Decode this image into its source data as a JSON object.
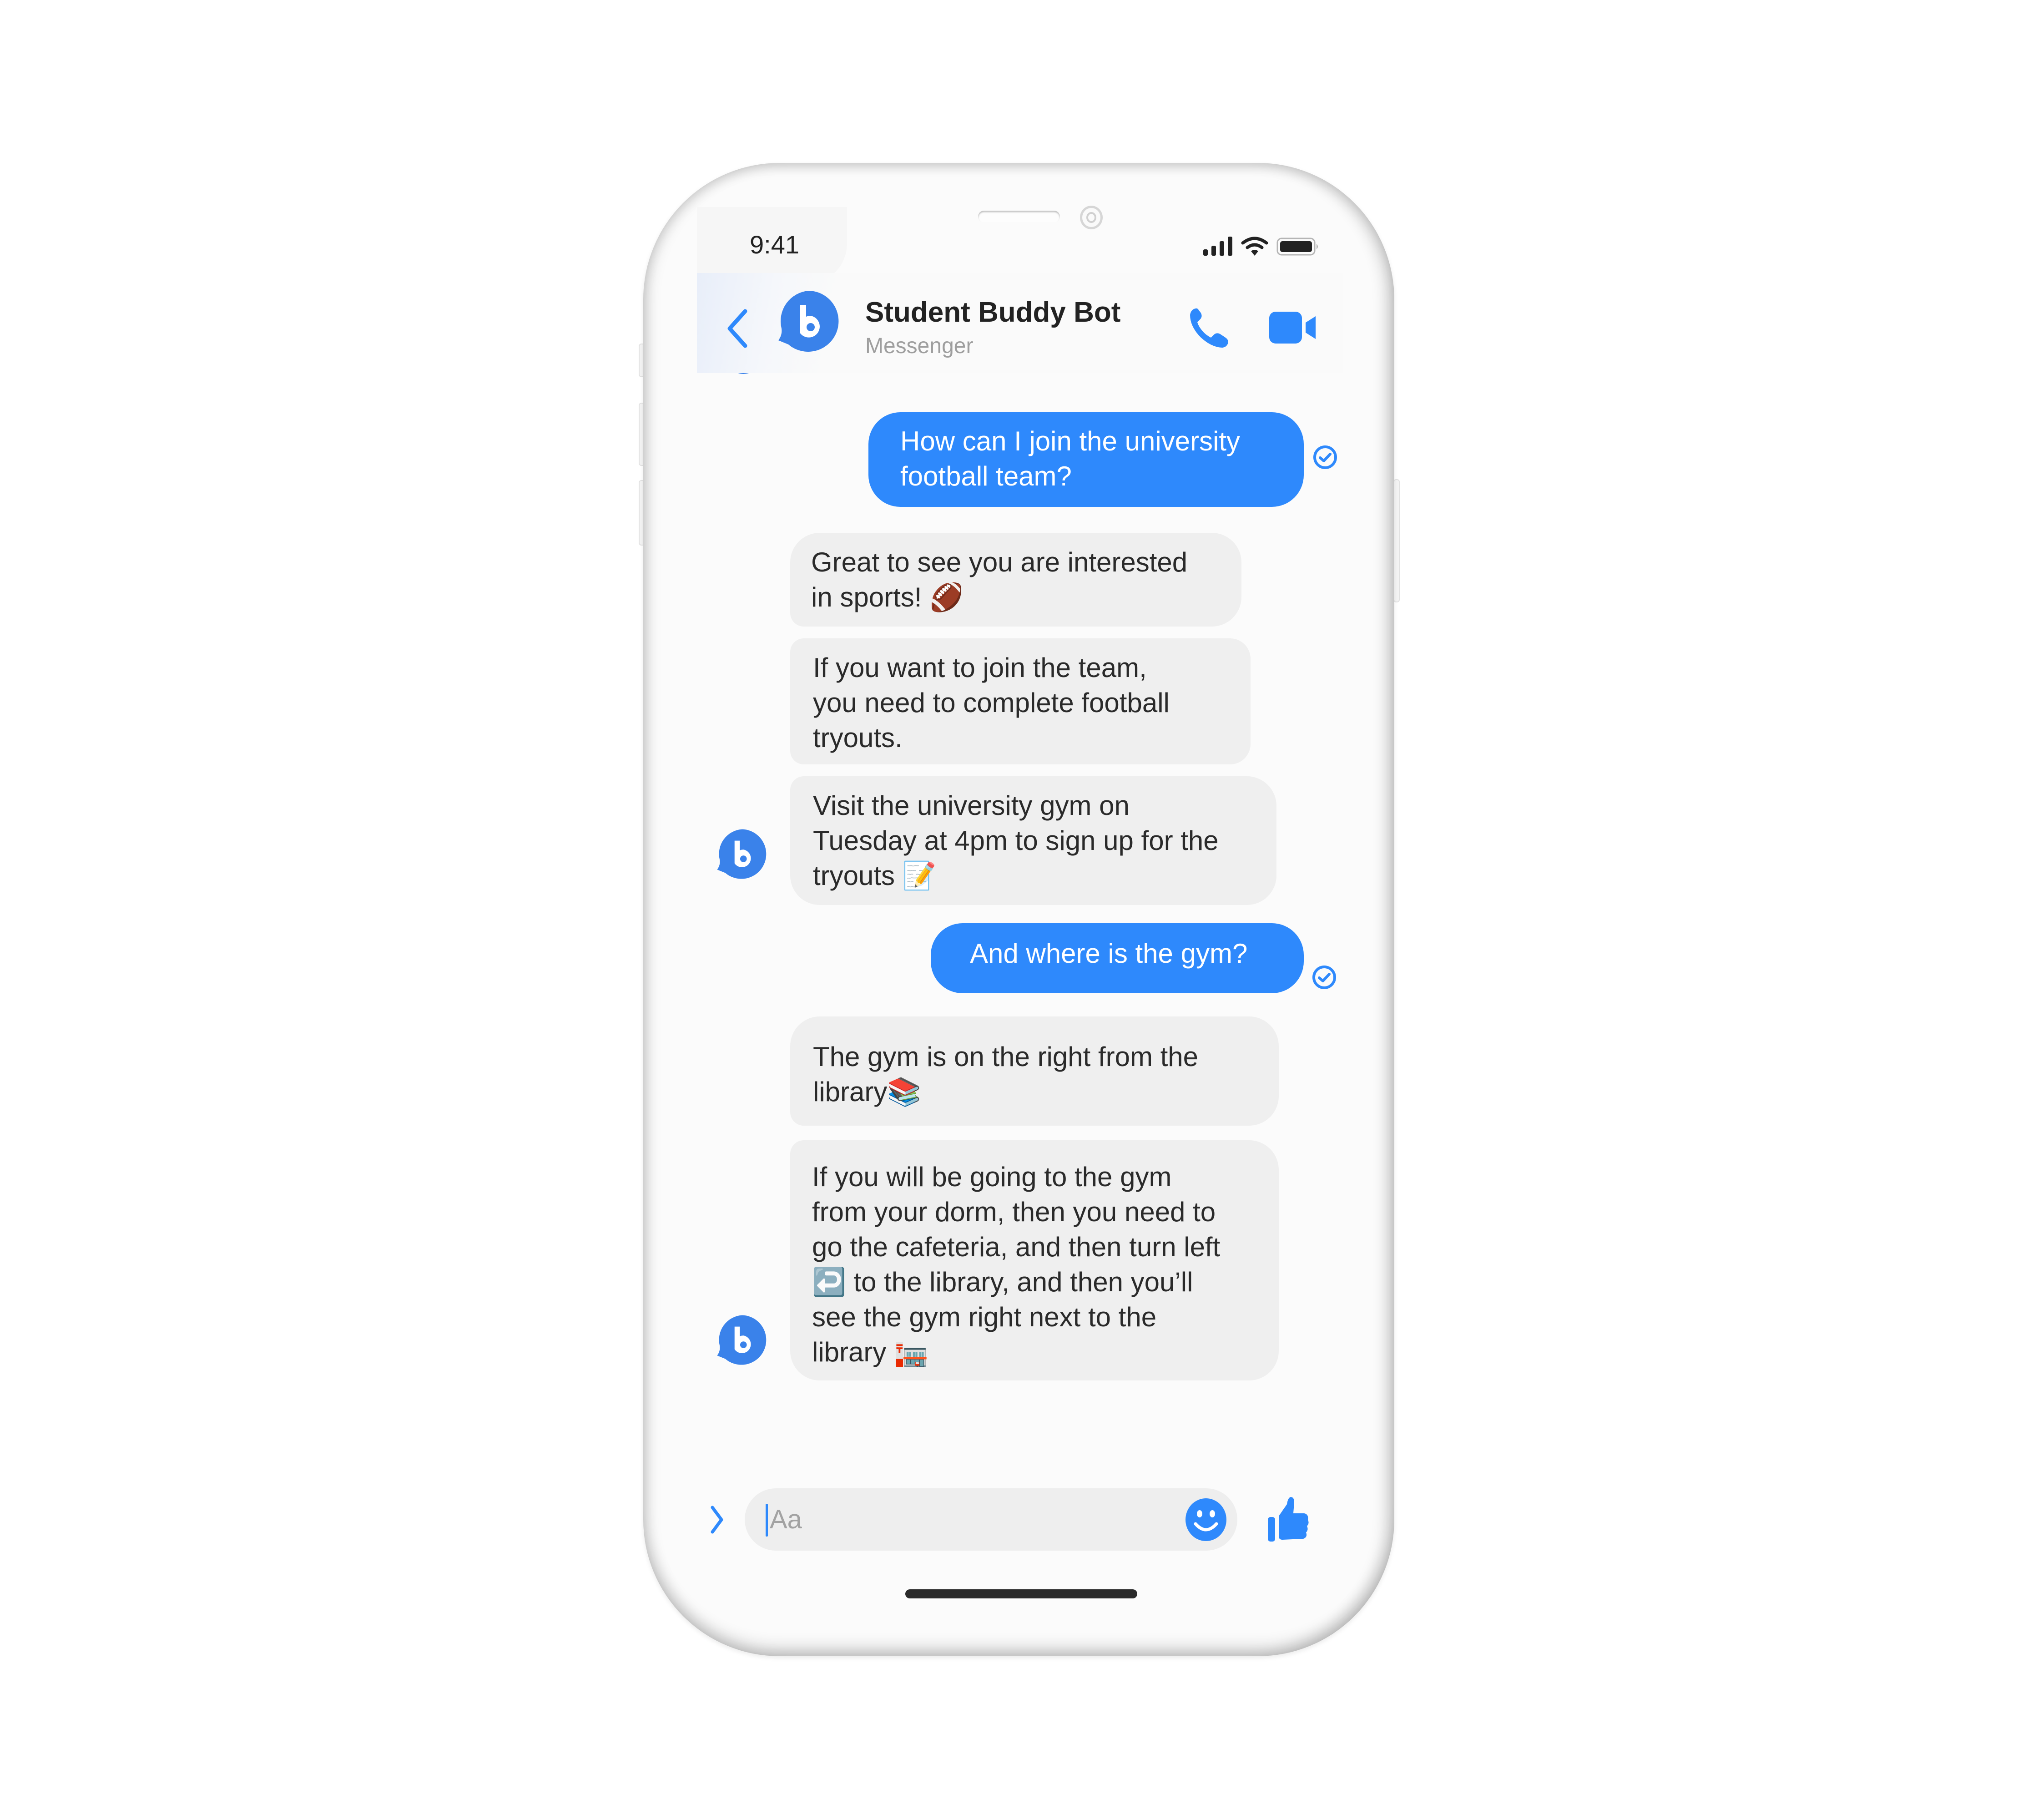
{
  "status_bar": {
    "time": "9:41",
    "icons": [
      "signal-icon",
      "wifi-icon",
      "battery-icon"
    ]
  },
  "header": {
    "back_icon": "chevron-left-icon",
    "avatar_letter": "b",
    "title": "Student Buddy Bot",
    "subtitle": "Messenger",
    "actions": [
      "phone-icon",
      "video-camera-icon"
    ]
  },
  "colors": {
    "accent": "#2e89fc",
    "avatar": "#3a82ea",
    "bot_bubble": "#efefef",
    "text": "#2a2a2a",
    "muted": "#9e9e9e"
  },
  "messages": [
    {
      "sender": "user",
      "lines": [
        "How can I join the university",
        "football team?"
      ],
      "status": "sent-check-icon"
    },
    {
      "sender": "bot",
      "lines": [
        "Great to see you are interested",
        "in sports! 🏈"
      ]
    },
    {
      "sender": "bot",
      "lines": [
        "If you want to join the team,",
        "you need to complete football",
        "tryouts."
      ]
    },
    {
      "sender": "bot",
      "lines": [
        "Visit the university gym on",
        "Tuesday at 4pm to sign up for the",
        "tryouts 📝"
      ],
      "avatar": "b"
    },
    {
      "sender": "user",
      "lines": [
        "And where is the gym?"
      ],
      "status": "sent-check-icon"
    },
    {
      "sender": "bot",
      "lines": [
        "The gym is on the right from the",
        "library📚"
      ]
    },
    {
      "sender": "bot",
      "lines": [
        "If you will be going to the gym",
        "from your dorm, then you need to",
        "go the cafeteria, and then turn left",
        "↩️ to the library, and then you’ll",
        "see the gym right next to the",
        "library 🏣"
      ],
      "avatar": "b"
    }
  ],
  "composer": {
    "expand_icon": "chevron-right-icon",
    "placeholder": "Aa",
    "emoji_icon": "smiley-icon",
    "like_icon": "thumbs-up-icon"
  }
}
